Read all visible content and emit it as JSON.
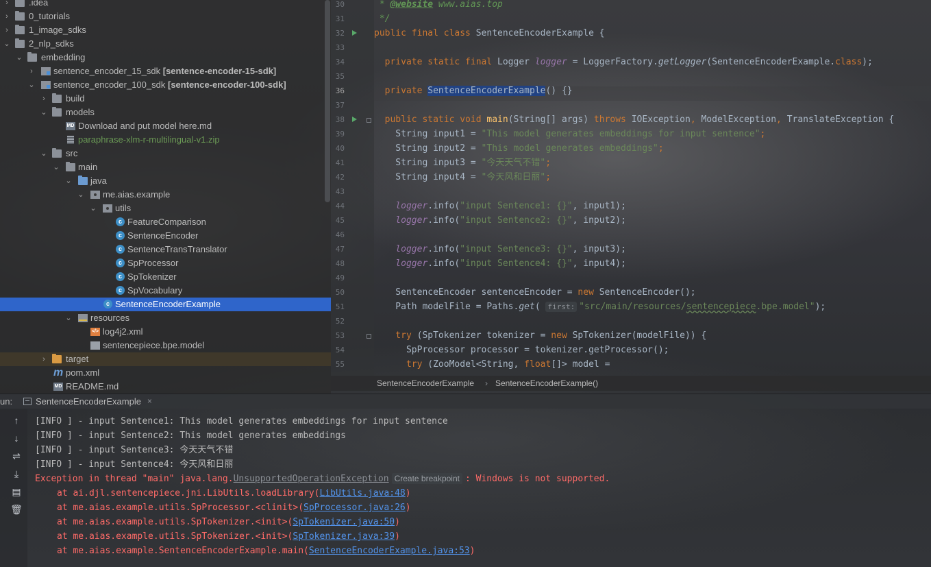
{
  "tree": {
    "items": [
      {
        "label": ".idea"
      },
      {
        "label": "0_tutorials"
      },
      {
        "label": "1_image_sdks"
      },
      {
        "label": "2_nlp_sdks"
      },
      {
        "label": "embedding"
      },
      {
        "label": "sentence_encoder_15_sdk",
        "suffix": "[sentence-encoder-15-sdk]"
      },
      {
        "label": "sentence_encoder_100_sdk",
        "suffix": "[sentence-encoder-100-sdk]"
      },
      {
        "label": "build"
      },
      {
        "label": "models"
      },
      {
        "label": "Download and put model here.md"
      },
      {
        "label": "paraphrase-xlm-r-multilingual-v1.zip"
      },
      {
        "label": "src"
      },
      {
        "label": "main"
      },
      {
        "label": "java"
      },
      {
        "label": "me.aias.example"
      },
      {
        "label": "utils"
      },
      {
        "label": "FeatureComparison"
      },
      {
        "label": "SentenceEncoder"
      },
      {
        "label": "SentenceTransTranslator"
      },
      {
        "label": "SpProcessor"
      },
      {
        "label": "SpTokenizer"
      },
      {
        "label": "SpVocabulary"
      },
      {
        "label": "SentenceEncoderExample"
      },
      {
        "label": "resources"
      },
      {
        "label": "log4j2.xml"
      },
      {
        "label": "sentencepiece.bpe.model"
      },
      {
        "label": "target"
      },
      {
        "label": "pom.xml"
      },
      {
        "label": "README.md"
      }
    ]
  },
  "editor": {
    "line_numbers": [
      "30",
      "31",
      "32",
      "33",
      "34",
      "35",
      "36",
      "37",
      "38",
      "39",
      "40",
      "41",
      "42",
      "43",
      "44",
      "45",
      "46",
      "47",
      "48",
      "49",
      "50",
      "51",
      "52",
      "53",
      "54",
      "55"
    ],
    "current_line": "36",
    "code": {
      "l30_prefix": " * ",
      "l30_tag": "@website",
      "l30_rest": " www.aias.top",
      "l31": " */",
      "l32_kw": "public final class ",
      "l32_rest": "SentenceEncoderExample {",
      "l34_kw": "  private static final ",
      "l34_type": "Logger ",
      "l34_field": "logger",
      "l34_eq": " = LoggerFactory.",
      "l34_method": "getLogger",
      "l34_arg": "(SentenceEncoderExample.",
      "l34_class_kw": "class",
      "l34_end": ");",
      "l36_kw": "  private ",
      "l36_name": "SentenceEncoderExample",
      "l36_rest": "() {}",
      "l38_kw": "  public static void ",
      "l38_method": "main",
      "l38_params": "(String[] args) ",
      "l38_throws": "throws ",
      "l38_ex1": "IOException",
      "l38_comma": ", ",
      "l38_ex2": "ModelException",
      "l38_ex3": "TranslateException {",
      "l39_decl": "    String input1 = ",
      "l39_str": "\"This model generates embeddings for input sentence\"",
      "l40_decl": "    String input2 = ",
      "l40_str": "\"This model generates embeddings\"",
      "l41_decl": "    String input3 = ",
      "l41_str": "\"今天天气不错\"",
      "l42_decl": "    String input4 = ",
      "l42_str": "\"今天风和日丽\"",
      "l44_field": "    logger",
      "l44_call": ".info(",
      "l44_str": "\"input Sentence1: {}\"",
      "l44_end": ", input1);",
      "l45_field": "    logger",
      "l45_call": ".info(",
      "l45_str": "\"input Sentence2: {}\"",
      "l45_end": ", input2);",
      "l47_field": "    logger",
      "l47_call": ".info(",
      "l47_str": "\"input Sentence3: {}\"",
      "l47_end": ", input3);",
      "l48_field": "    logger",
      "l48_call": ".info(",
      "l48_str": "\"input Sentence4: {}\"",
      "l48_end": ", input4);",
      "l50_decl": "    SentenceEncoder sentenceEncoder = ",
      "l50_new": "new ",
      "l50_end": "SentenceEncoder();",
      "l51_decl": "    Path modelFile = Paths.",
      "l51_method": "get",
      "l51_paren": "( ",
      "l51_hint": "first:",
      "l51_str1": "\"src/main/resources/",
      "l51_str2": "sentencepiece",
      "l51_str3": ".bpe.model\"",
      "l51_end": ");",
      "l53_kw": "    try ",
      "l53_mid": "(SpTokenizer tokenizer = ",
      "l53_new": "new ",
      "l53_end": "SpTokenizer(modelFile)) {",
      "l54_decl": "      SpProcessor processor = tokenizer.getProcessor();",
      "l55_kw": "      try ",
      "l55_mid": "(ZooModel<String, ",
      "l55_float": "float",
      "l55_end": "[]> model ="
    }
  },
  "breadcrumb": {
    "class": "SentenceEncoderExample",
    "separator": "›",
    "method": "SentenceEncoderExample()"
  },
  "run": {
    "label": "un:",
    "tab_title": "SentenceEncoderExample",
    "tab_close": "×",
    "console": {
      "l1": "[INFO ] - input Sentence1: This model generates embeddings for input sentence",
      "l2": "[INFO ] - input Sentence2: This model generates embeddings",
      "l3": "[INFO ] - input Sentence3: 今天天气不错",
      "l4": "[INFO ] - input Sentence4: 今天风和日丽",
      "ex_prefix": "Exception in thread \"main\" java.lang.",
      "ex_class": "UnsupportedOperationException",
      "ex_hint": "Create breakpoint",
      "ex_msg": ": Windows is not supported.",
      "s1_at": "at ai.djl.sentencepiece.jni.LibUtils.loadLibrary(",
      "s1_link": "LibUtils.java:48",
      "s2_at": "at me.aias.example.utils.SpProcessor.<clinit>(",
      "s2_link": "SpProcessor.java:26",
      "s3_at": "at me.aias.example.utils.SpTokenizer.<init>(",
      "s3_link": "SpTokenizer.java:50",
      "s4_at": "at me.aias.example.utils.SpTokenizer.<init>(",
      "s4_link": "SpTokenizer.java:39",
      "s5_at": "at me.aias.example.SentenceEncoderExample.main(",
      "s5_link": "SentenceEncoderExample.java:53",
      "close_paren": ")"
    }
  },
  "colors": {
    "keyword": "#cc7832",
    "string": "#6a8759",
    "field": "#9876aa",
    "error": "#ff6b68",
    "link": "#5394ec",
    "selection": "#2f65ca"
  },
  "icons": {
    "run_toolbar": [
      "arrow-up-icon",
      "arrow-down-icon",
      "soft-wrap-icon",
      "scroll-to-end-icon",
      "print-icon",
      "trash-icon"
    ]
  }
}
